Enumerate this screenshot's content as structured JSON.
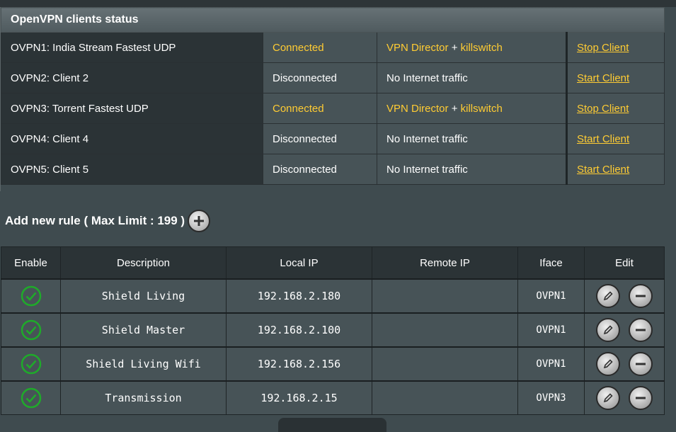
{
  "status": {
    "title": "OpenVPN clients status",
    "clients": [
      {
        "name": "OVPN1: India Stream Fastest UDP",
        "state": "Connected",
        "traffic_main": "VPN Director",
        "traffic_sep": "+",
        "traffic_extra": "killswitch",
        "action": "Stop Client",
        "active": true
      },
      {
        "name": "OVPN2: Client 2",
        "state": "Disconnected",
        "traffic_main": "No Internet traffic",
        "traffic_sep": "",
        "traffic_extra": "",
        "action": "Start Client",
        "active": false
      },
      {
        "name": "OVPN3: Torrent Fastest UDP",
        "state": "Connected",
        "traffic_main": "VPN Director",
        "traffic_sep": "+",
        "traffic_extra": "killswitch",
        "action": "Stop Client",
        "active": true
      },
      {
        "name": "OVPN4: Client 4",
        "state": "Disconnected",
        "traffic_main": "No Internet traffic",
        "traffic_sep": "",
        "traffic_extra": "",
        "action": "Start Client",
        "active": false
      },
      {
        "name": "OVPN5: Client 5",
        "state": "Disconnected",
        "traffic_main": "No Internet traffic",
        "traffic_sep": "",
        "traffic_extra": "",
        "action": "Start Client",
        "active": false
      }
    ]
  },
  "add_rule": {
    "label": "Add new rule ( Max Limit : 199 )"
  },
  "rules": {
    "headers": [
      "Enable",
      "Description",
      "Local IP",
      "Remote IP",
      "Iface",
      "Edit"
    ],
    "rows": [
      {
        "description": "Shield Living",
        "local_ip": "192.168.2.180",
        "remote_ip": "",
        "iface": "OVPN1"
      },
      {
        "description": "Shield Master",
        "local_ip": "192.168.2.100",
        "remote_ip": "",
        "iface": "OVPN1"
      },
      {
        "description": "Shield Living Wifi",
        "local_ip": "192.168.2.156",
        "remote_ip": "",
        "iface": "OVPN1"
      },
      {
        "description": "Transmission",
        "local_ip": "192.168.2.15",
        "remote_ip": "",
        "iface": "OVPN3"
      }
    ]
  },
  "colors": {
    "accent_yellow": "#ffcc33",
    "enabled_green": "#1faa2a"
  }
}
